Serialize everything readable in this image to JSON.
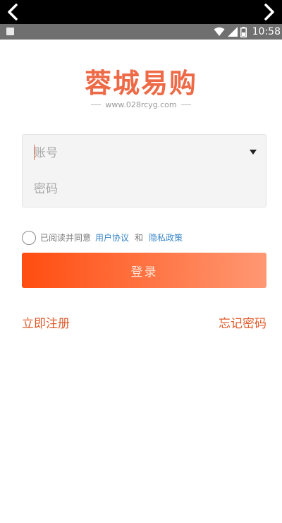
{
  "status_bar": {
    "time": "10:58"
  },
  "logo": {
    "title": "蓉城易购",
    "subtitle": "www.028rcyg.com"
  },
  "form": {
    "account_placeholder": "账号",
    "password_placeholder": "密码"
  },
  "agreement": {
    "prefix": "已阅读并同意",
    "user_agreement": "用户协议",
    "and": "和",
    "privacy_policy": "隐私政策",
    "checked": false
  },
  "login_button": {
    "label": "登录"
  },
  "links": {
    "register": "立即注册",
    "forgot_password": "忘记密码"
  },
  "colors": {
    "brand": "#ee6a47",
    "button_start": "#ff4d10",
    "button_end": "#ff9873",
    "link_blue": "#3a86c8",
    "link_orange": "#e05a2a"
  },
  "icons": {
    "nav_back": "chevron-left-icon",
    "nav_forward": "chevron-right-icon",
    "dropdown": "triangle-down-icon"
  }
}
